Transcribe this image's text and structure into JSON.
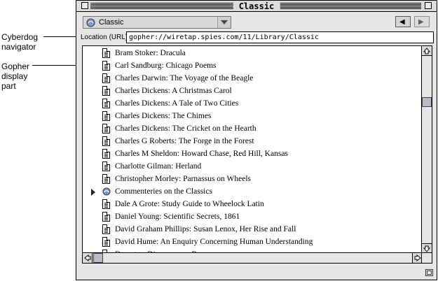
{
  "annotations": {
    "navigator": [
      "Cyberdog",
      "navigator"
    ],
    "display_part": [
      "Gopher",
      "display",
      "part"
    ]
  },
  "window": {
    "title": "Classic"
  },
  "toolbar": {
    "popup_label": "Classic",
    "popup_icon": "gopher-icon",
    "back_icon": "left-arrow-icon",
    "forward_icon": "right-arrow-icon"
  },
  "location": {
    "label": "Location (URL):",
    "value": "gopher://wiretap.spies.com/11/Library/Classic"
  },
  "list": {
    "items": [
      {
        "label": "Bram Stoker: Dracula",
        "type": "document"
      },
      {
        "label": "Carl Sandburg: Chicago Poems",
        "type": "document"
      },
      {
        "label": "Charles Darwin: The Voyage of the Beagle",
        "type": "document"
      },
      {
        "label": "Charles Dickens: A Christmas Carol",
        "type": "document"
      },
      {
        "label": "Charles Dickens: A Tale of Two Cities",
        "type": "document"
      },
      {
        "label": "Charles Dickens: The Chimes",
        "type": "document"
      },
      {
        "label": "Charles Dickens: The Cricket on the Hearth",
        "type": "document"
      },
      {
        "label": "Charles G Roberts: The Forge in the Forest",
        "type": "document"
      },
      {
        "label": "Charles M Sheldon: Howard Chase, Red Hill, Kansas",
        "type": "document"
      },
      {
        "label": "Charlotte Gilman: Herland",
        "type": "document"
      },
      {
        "label": "Christopher Morley: Parnassus on Wheels",
        "type": "document"
      },
      {
        "label": "Commenteries on the Classics",
        "type": "folder"
      },
      {
        "label": "Dale A Grote: Study Guide to Wheelock Latin",
        "type": "document"
      },
      {
        "label": "Daniel Young: Scientific Secrets, 1861",
        "type": "document"
      },
      {
        "label": "David Graham Phillips: Susan Lenox, Her Rise and Fall",
        "type": "document"
      },
      {
        "label": "David Hume: An Enquiry Concerning Human Understanding",
        "type": "document"
      },
      {
        "label": "Decartes: Discourse on Reason",
        "type": "document"
      }
    ]
  },
  "colors": {
    "window_bg": "#e6e6e6",
    "scroll_thumb": "#b9b9c8",
    "list_bg": "#ffffff"
  }
}
